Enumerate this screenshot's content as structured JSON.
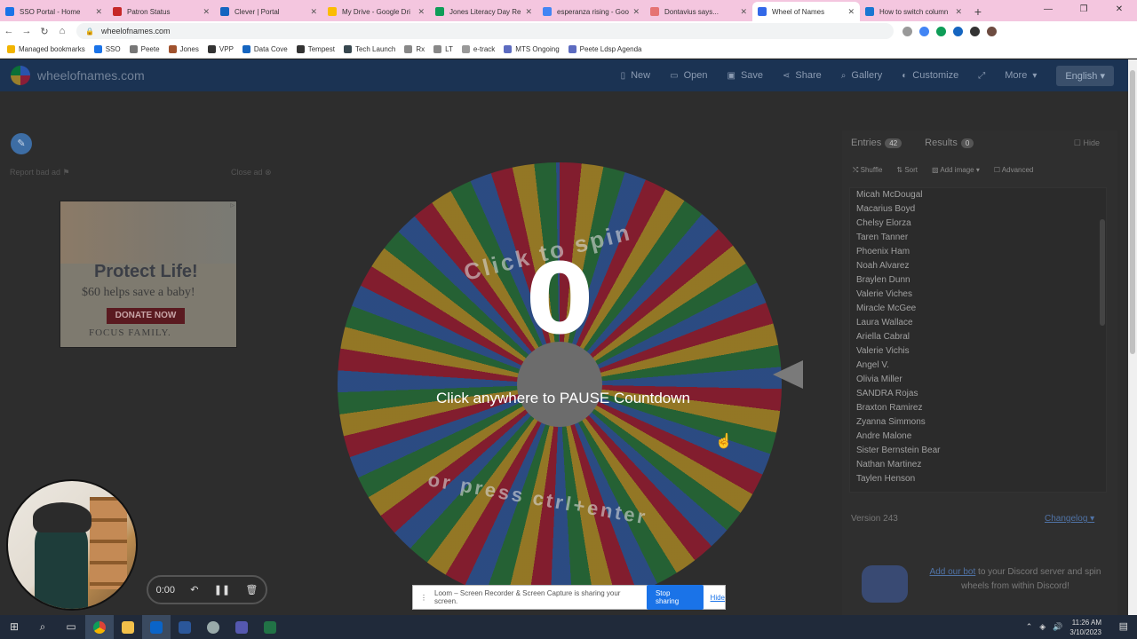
{
  "browser": {
    "tabs": [
      {
        "title": "SSO Portal - Home",
        "color": "#1a73e8"
      },
      {
        "title": "Patron Status",
        "color": "#c62828"
      },
      {
        "title": "Clever | Portal",
        "color": "#1565c0"
      },
      {
        "title": "My Drive - Google Dri",
        "color": "#fbbc04"
      },
      {
        "title": "Jones Literacy Day Re",
        "color": "#0f9d58"
      },
      {
        "title": "esperanza rising - Goo",
        "color": "#4285f4"
      },
      {
        "title": "Dontavius says...",
        "color": "#e57373"
      },
      {
        "title": "Wheel of Names",
        "color": "#3369e8",
        "active": true
      },
      {
        "title": "How to switch column",
        "color": "#1976d2"
      }
    ],
    "url": "wheelofnames.com",
    "bookmarks": [
      {
        "label": "Managed bookmarks",
        "color": "#f2b400"
      },
      {
        "label": "SSO",
        "color": "#1a73e8"
      },
      {
        "label": "Peete",
        "color": "#777"
      },
      {
        "label": "Jones",
        "color": "#a0522d"
      },
      {
        "label": "VPP",
        "color": "#333"
      },
      {
        "label": "Data Cove",
        "color": "#1565c0"
      },
      {
        "label": "Tempest",
        "color": "#333"
      },
      {
        "label": "Tech Launch",
        "color": "#37474f"
      },
      {
        "label": "Rx",
        "color": "#888"
      },
      {
        "label": "LT",
        "color": "#888"
      },
      {
        "label": "e-track",
        "color": "#999"
      },
      {
        "label": "MTS Ongoing",
        "color": "#5c6bc0"
      },
      {
        "label": "Peete Ldsp Agenda",
        "color": "#5c6bc0"
      }
    ]
  },
  "site": {
    "brand": "wheelofnames.com",
    "menu": {
      "new": "New",
      "open": "Open",
      "save": "Save",
      "share": "Share",
      "gallery": "Gallery",
      "customize": "Customize",
      "more": "More",
      "language": "English"
    },
    "report_ad": "Report bad ad",
    "close_ad": "Close ad",
    "ad": {
      "headline": "Protect Life!",
      "subline": "$60 helps save a baby!",
      "button": "DONATE NOW",
      "sponsor": "FOCUS FAMILY."
    },
    "wheel": {
      "countdown": "0",
      "pause_message": "Click anywhere to PAUSE Countdown",
      "top_text": "Click to spin",
      "bottom_text": "or press ctrl+enter"
    },
    "panel": {
      "tab_entries": "Entries",
      "entries_count": "42",
      "tab_results": "Results",
      "results_count": "0",
      "hide": "Hide",
      "shuffle": "Shuffle",
      "sort": "Sort",
      "add_image": "Add image",
      "advanced": "Advanced",
      "entries": [
        "Micah McDougal",
        "Macarius Boyd",
        "Chelsy Elorza",
        "Taren Tanner",
        "Phoenix Ham",
        "Noah Alvarez",
        "Braylen Dunn",
        "Valerie Viches",
        "Miracle McGee",
        "Laura Wallace",
        "Ariella Cabral",
        "Valerie Vichis",
        "Angel V.",
        "Olivia Miller",
        "SANDRA Rojas",
        "Braxton Ramirez",
        "Zyanna Simmons",
        "Andre Malone",
        "Sister Bernstein Bear",
        "Nathan Martinez",
        "Taylen Henson"
      ],
      "version": "Version 243",
      "changelog": "Changelog",
      "discord_link": "Add our bot",
      "discord_text": " to your Discord server and spin wheels from within Discord!"
    }
  },
  "recorder": {
    "time": "0:00",
    "loom_text": "Loom – Screen Recorder & Screen Capture is sharing your screen.",
    "stop": "Stop sharing",
    "hide": "Hide"
  },
  "taskbar": {
    "time": "11:26 AM",
    "date": "3/10/2023"
  }
}
